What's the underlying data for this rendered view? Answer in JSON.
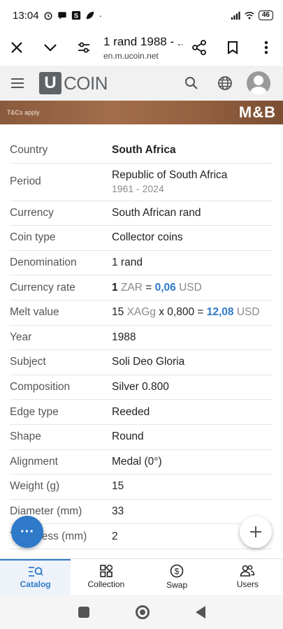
{
  "status_bar": {
    "time": "13:04",
    "battery": "46",
    "icons": [
      "alarm-icon",
      "message-icon",
      "s-app-icon",
      "leaf-icon",
      "wifi-icon",
      "signal-icon"
    ]
  },
  "browser": {
    "page_title": "1 rand 1988 - ...",
    "domain": "en.m.ucoin.net"
  },
  "site": {
    "logo_letter": "U",
    "logo_text": "COIN"
  },
  "ad": {
    "tc": "T&Cs apply.",
    "brand": "M&B"
  },
  "details": {
    "country": {
      "label": "Country",
      "value": "South Africa"
    },
    "period": {
      "label": "Period",
      "value": "Republic of South Africa",
      "years": "1961 - 2024"
    },
    "currency": {
      "label": "Currency",
      "value": "South African rand"
    },
    "coin_type": {
      "label": "Coin type",
      "value": "Collector coins"
    },
    "denomination": {
      "label": "Denomination",
      "value": "1 rand"
    },
    "currency_rate": {
      "label": "Currency rate",
      "amount": "1",
      "unit": "ZAR",
      "eq": " = ",
      "rate": "0,06",
      "target": "USD"
    },
    "melt_value": {
      "label": "Melt value",
      "amount": "15",
      "unit": "XAGg",
      "mult": " x 0,800 = ",
      "result": "12,08",
      "target": "USD"
    },
    "year": {
      "label": "Year",
      "value": "1988"
    },
    "subject": {
      "label": "Subject",
      "value": "Soli Deo Gloria"
    },
    "composition": {
      "label": "Composition",
      "value": "Silver 0.800"
    },
    "edge_type": {
      "label": "Edge type",
      "value": "Reeded"
    },
    "shape": {
      "label": "Shape",
      "value": "Round"
    },
    "alignment": {
      "label": "Alignment",
      "value": "Medal (0°)"
    },
    "weight": {
      "label": "Weight (g)",
      "value": "15"
    },
    "diameter": {
      "label": "Diameter (mm)",
      "value": "33"
    },
    "thickness": {
      "label": "Thickness (mm)",
      "value": "2"
    }
  },
  "fab": {
    "more": "···",
    "add": "+"
  },
  "bottom_nav": [
    {
      "label": "Catalog",
      "active": true
    },
    {
      "label": "Collection",
      "active": false
    },
    {
      "label": "Swap",
      "active": false
    },
    {
      "label": "Users",
      "active": false
    }
  ],
  "colors": {
    "accent": "#2f79c9",
    "header_bg": "#f1f1f1",
    "logo_gray": "#5e6368"
  }
}
